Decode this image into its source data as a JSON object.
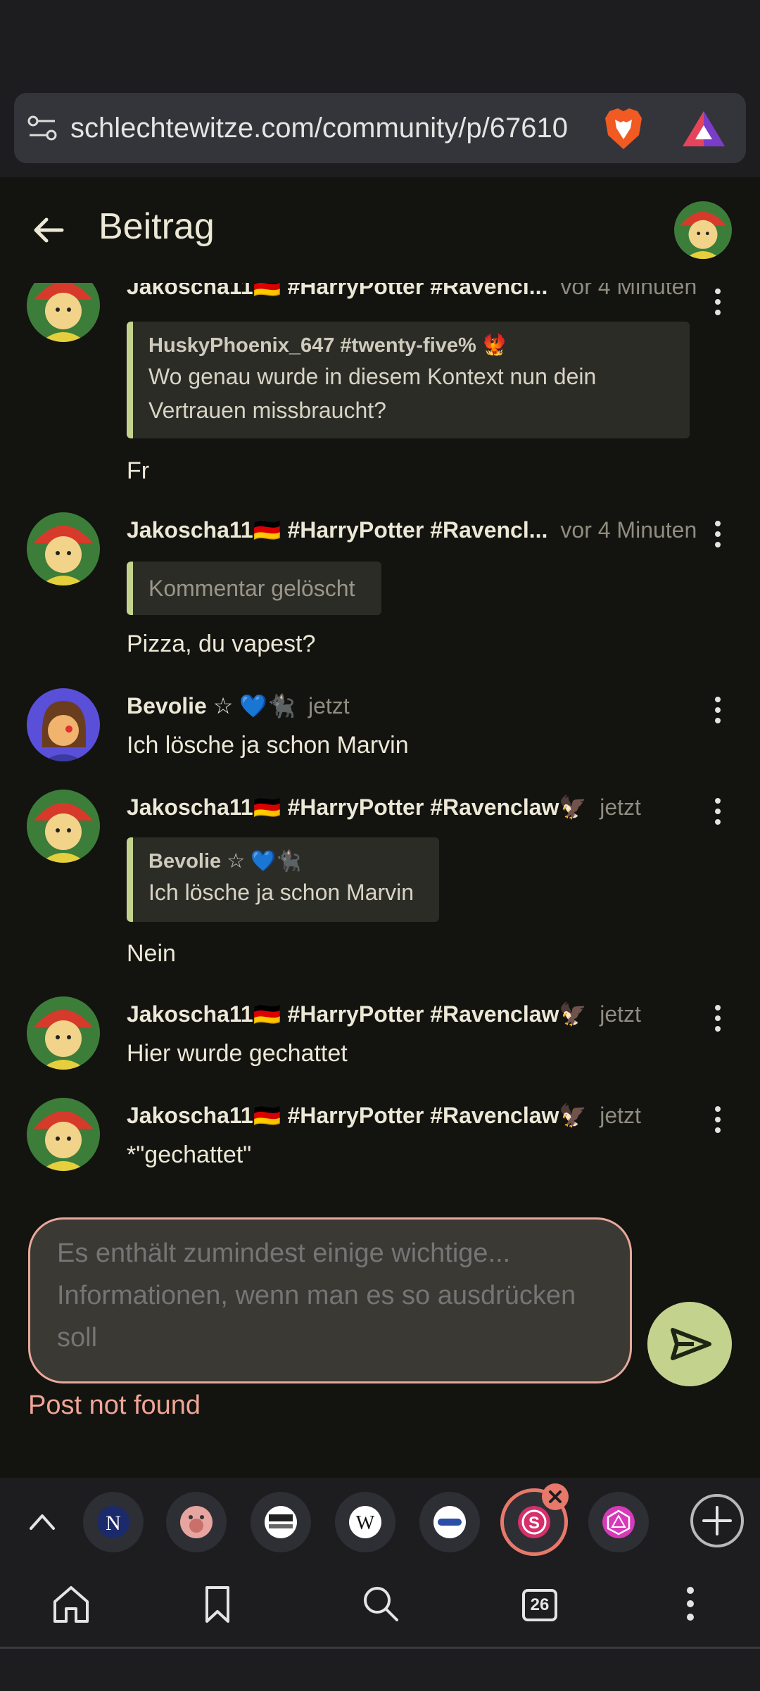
{
  "browser": {
    "url": "schlechtewitze.com/community/p/67610",
    "tab_count": "26"
  },
  "header": {
    "title": "Beitrag"
  },
  "comments": [
    {
      "author": "Jakoscha11🇩🇪 #HarryPotter #Ravencl...",
      "time": "vor 4 Minuten",
      "quote_author": "HuskyPhoenix_647 #twenty-five% 🐦‍🔥",
      "quote_text": "Wo genau wurde in diesem Kontext nun dein Vertrauen missbraucht?",
      "body": "Fr"
    },
    {
      "author": "Jakoscha11🇩🇪 #HarryPotter #Ravencl...",
      "time": "vor 4 Minuten",
      "quote_deleted": "Kommentar gelöscht",
      "body": "Pizza, du vapest?"
    },
    {
      "author": "Bevolie ☆ 💙🐈‍⬛",
      "time": "jetzt",
      "body": "Ich lösche ja schon Marvin"
    },
    {
      "author": "Jakoscha11🇩🇪 #HarryPotter #Ravenclaw🦅",
      "time": "jetzt",
      "quote_author": "Bevolie ☆ 💙🐈‍⬛",
      "quote_text": "Ich lösche ja schon Marvin",
      "body": "Nein"
    },
    {
      "author": "Jakoscha11🇩🇪 #HarryPotter #Ravenclaw🦅",
      "time": "jetzt",
      "body": "Hier wurde gechattet"
    },
    {
      "author": "Jakoscha11🇩🇪 #HarryPotter #Ravenclaw🦅",
      "time": "jetzt",
      "body": "*\"gechattet\""
    }
  ],
  "composer": {
    "placeholder": "Es enthält zumindest einige wichtige... Informationen, wenn man es so ausdrücken soll",
    "error": "Post not found"
  },
  "tabs": [
    {
      "icon": "letter-n-shield-icon",
      "active": false
    },
    {
      "icon": "pig-face-icon",
      "active": false
    },
    {
      "icon": "uncut-news-icon",
      "active": false
    },
    {
      "icon": "wikipedia-icon",
      "active": false
    },
    {
      "icon": "pill-logo-icon",
      "active": false
    },
    {
      "icon": "letter-s-icon",
      "active": true
    },
    {
      "icon": "d20-dice-icon",
      "active": false
    }
  ],
  "colors": {
    "accent": "#c3d38e",
    "error": "#f0a595",
    "active_tab_ring": "#e8796a",
    "background": "#131310"
  }
}
